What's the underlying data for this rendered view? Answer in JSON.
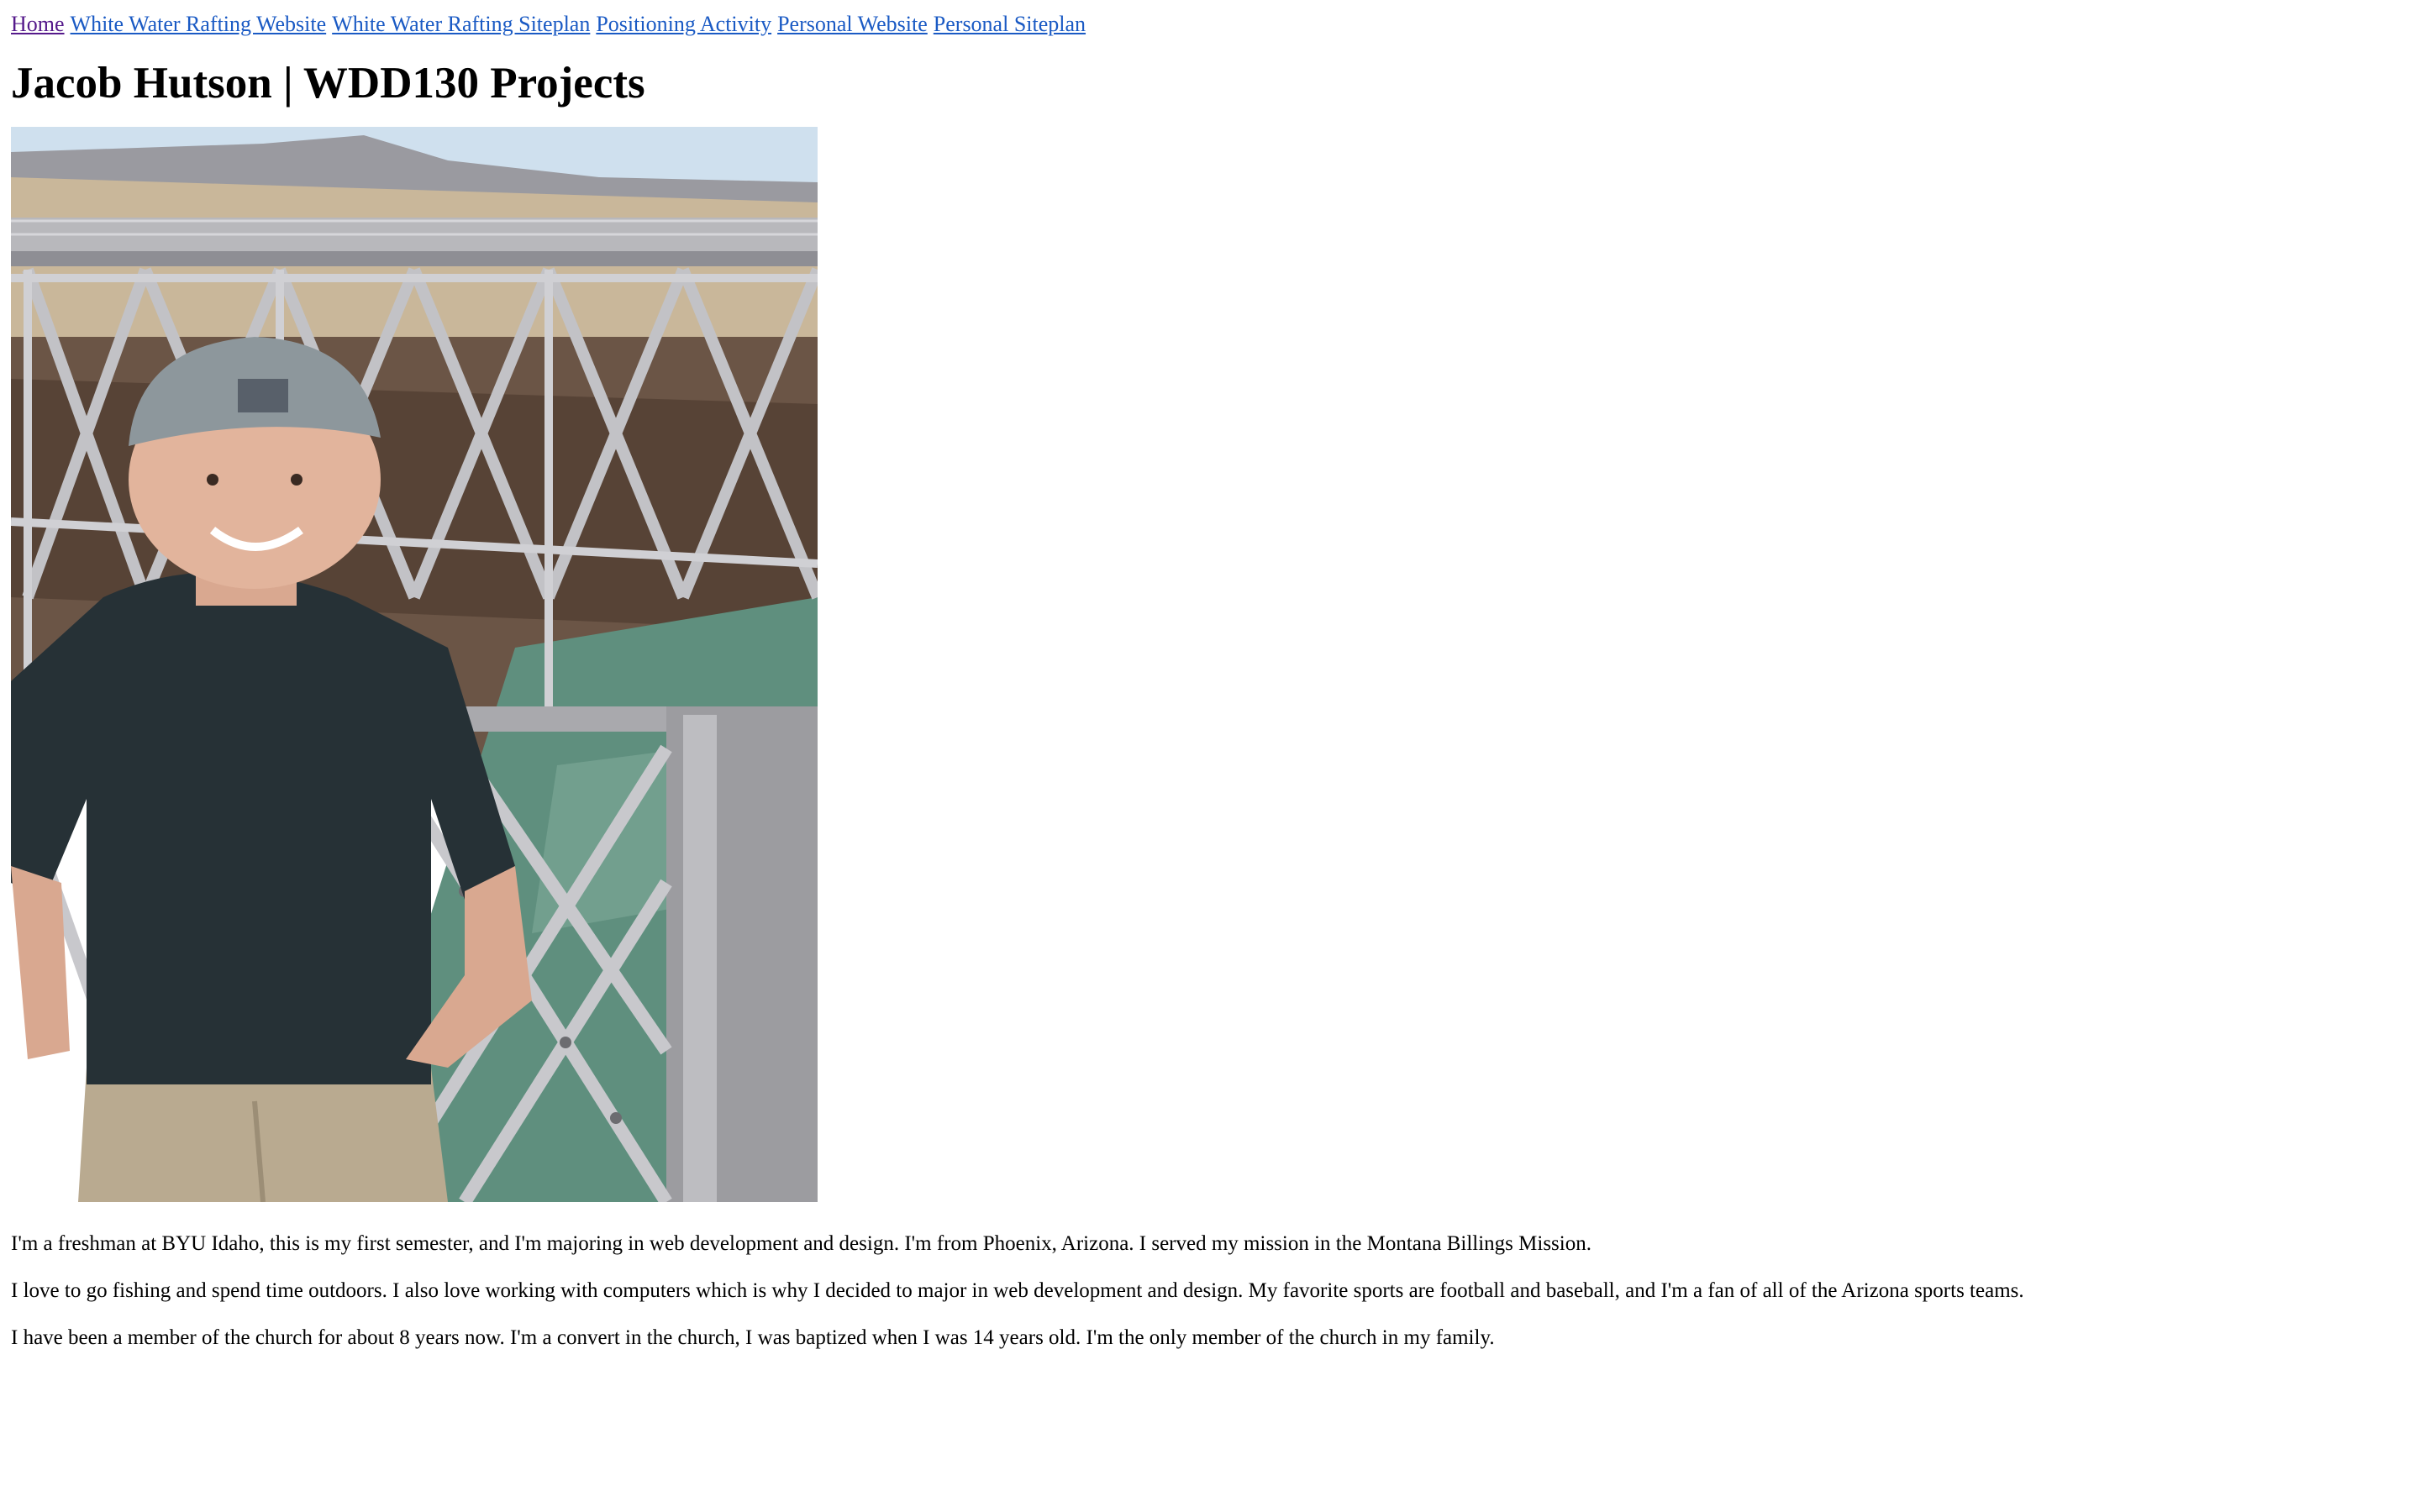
{
  "nav": {
    "items": [
      {
        "label": "Home",
        "visited": true
      },
      {
        "label": "White Water Rafting Website",
        "visited": false
      },
      {
        "label": "White Water Rafting Siteplan",
        "visited": false
      },
      {
        "label": "Positioning Activity",
        "visited": false
      },
      {
        "label": "Personal Website",
        "visited": false
      },
      {
        "label": "Personal Siteplan",
        "visited": false
      }
    ]
  },
  "page": {
    "title": "Jacob Hutson | WDD130 Projects"
  },
  "bio": {
    "paragraphs": [
      "I'm a freshman at BYU Idaho, this is my first semester, and I'm majoring in web development and design. I'm from Phoenix, Arizona. I served my mission in the Montana Billings Mission.",
      "I love to go fishing and spend time outdoors. I also love working with computers which is why I decided to major in web development and design. My favorite sports are football and baseball, and I'm a fan of all of the Arizona sports teams.",
      "I have been a member of the church for about 8 years now. I'm a convert in the church, I was baptized when I was 14 years old. I'm the only member of the church in my family."
    ]
  },
  "colors": {
    "link": "#1a5ac4",
    "visited_link": "#551a8b",
    "text": "#000000",
    "background": "#ffffff"
  }
}
